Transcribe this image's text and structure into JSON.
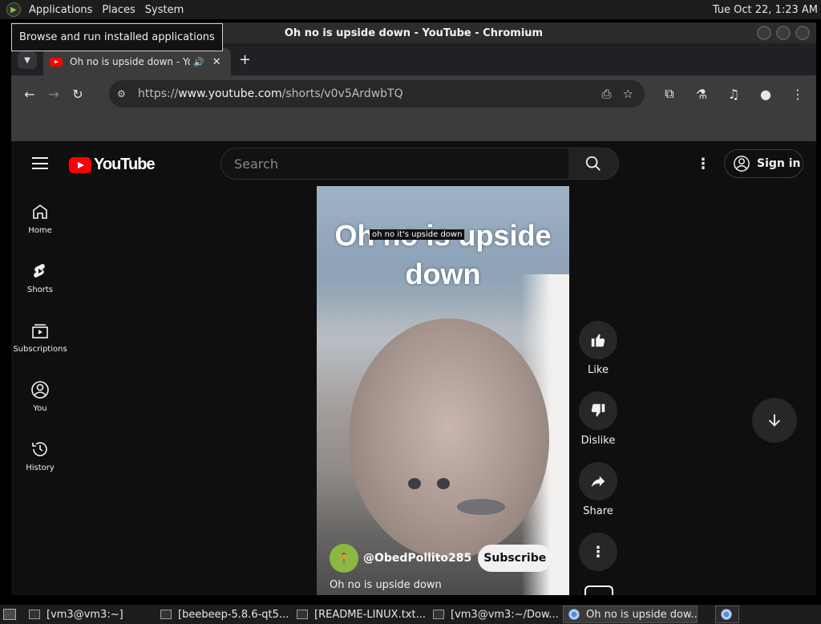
{
  "top_panel": {
    "menus": [
      "Applications",
      "Places",
      "System"
    ],
    "clock": "Tue Oct 22,  1:23 AM",
    "tooltip": "Browse and run installed applications"
  },
  "window": {
    "title": "Oh no is upside down - YouTube - Chromium"
  },
  "browser": {
    "tab_title": "Oh no is upside down - YouTube",
    "url_prefix": "https://",
    "url_host": "www.youtube.com",
    "url_path": "/shorts/v0v5ArdwbTQ"
  },
  "youtube": {
    "logo_text": "YouTube",
    "search_placeholder": "Search",
    "sign_in": "Sign in",
    "guide": [
      {
        "label": "Home",
        "icon": "home-icon"
      },
      {
        "label": "Shorts",
        "icon": "shorts-icon"
      },
      {
        "label": "Subscriptions",
        "icon": "subscriptions-icon"
      },
      {
        "label": "You",
        "icon": "you-icon"
      },
      {
        "label": "History",
        "icon": "history-icon"
      }
    ],
    "overlay_text": "Oh no is upside down",
    "caption": "oh no it's upside down",
    "channel_handle": "@ObedPollito285",
    "subscribe": "Subscribe",
    "video_title": "Oh no is upside down",
    "actions": {
      "like": "Like",
      "dislike": "Dislike",
      "share": "Share"
    }
  },
  "taskbar": {
    "tasks": [
      "[vm3@vm3:~]",
      "[beebeep-5.8.6-qt5...",
      "[README-LINUX.txt....",
      "[vm3@vm3:~/Dow...",
      "Oh no is upside dow..."
    ]
  }
}
